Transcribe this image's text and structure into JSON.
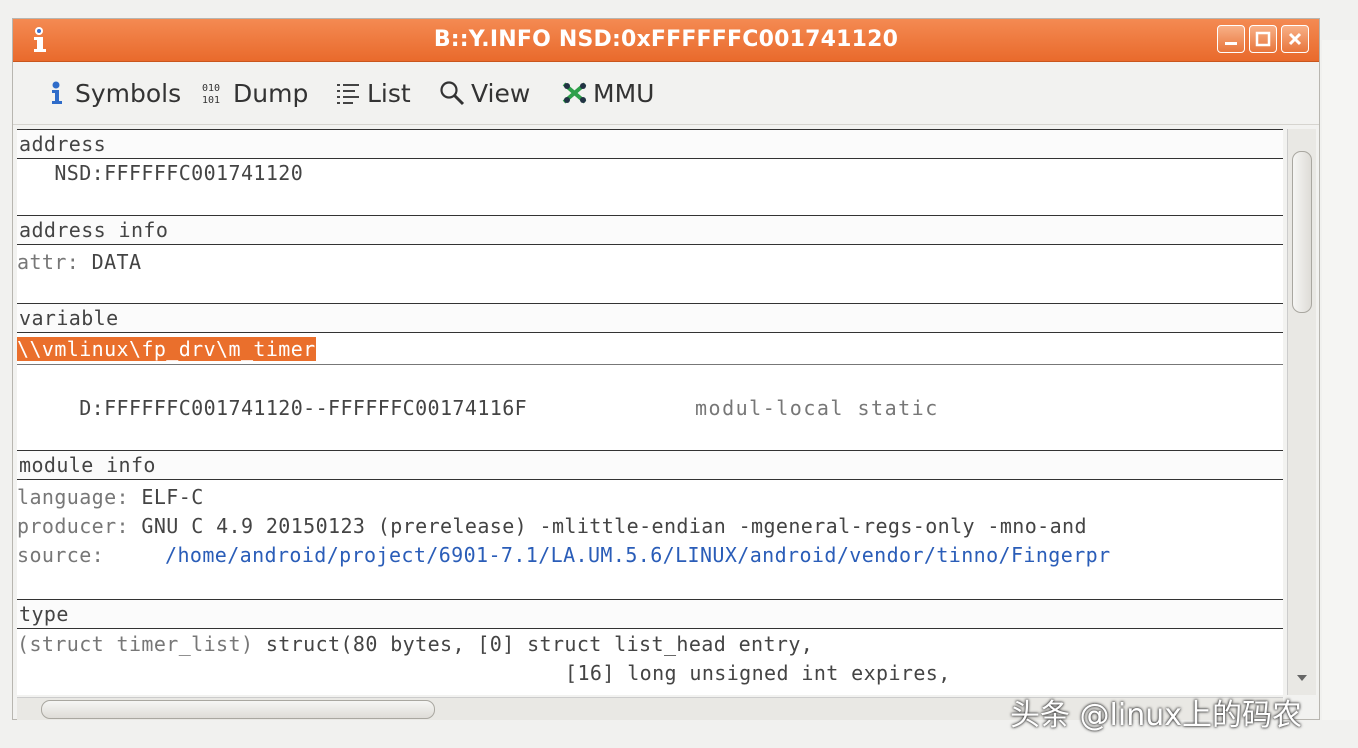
{
  "window": {
    "title": "B::Y.INFO NSD:0xFFFFFFC001741120"
  },
  "toolbar": {
    "symbols": "Symbols",
    "dump": "Dump",
    "list": "List",
    "view": "View",
    "mmu": "MMU"
  },
  "sections": {
    "address": {
      "header": "address",
      "value": "   NSD:FFFFFFC001741120"
    },
    "address_info": {
      "header": "address info",
      "attr_label": "attr:",
      "attr_value": " DATA"
    },
    "variable": {
      "header": "variable",
      "name": "\\\\vmlinux\\fp_drv\\m_timer",
      "range": "     D:FFFFFFC001741120--FFFFFFC00174116F",
      "scope": "modul-local static"
    },
    "module_info": {
      "header": "module info",
      "language_label": "language:",
      "language_value": " ELF-C",
      "producer_label": "producer:",
      "producer_value": " GNU C 4.9 20150123 (prerelease) -mlittle-endian -mgeneral-regs-only -mno-and",
      "source_label": "source:",
      "source_value": "/home/android/project/6901-7.1/LA.UM.5.6/LINUX/android/vendor/tinno/Fingerpr"
    },
    "type": {
      "header": "type",
      "decl": "(struct timer_list)",
      "line1": " struct(80 bytes, [0] struct list_head entry,",
      "line2": "[16] long unsigned int expires,"
    }
  },
  "watermark": "头条 @linux上的码农",
  "colors": {
    "titlebar": "#e96a2c",
    "highlight": "#ea6f2c",
    "path": "#2a5db8"
  }
}
